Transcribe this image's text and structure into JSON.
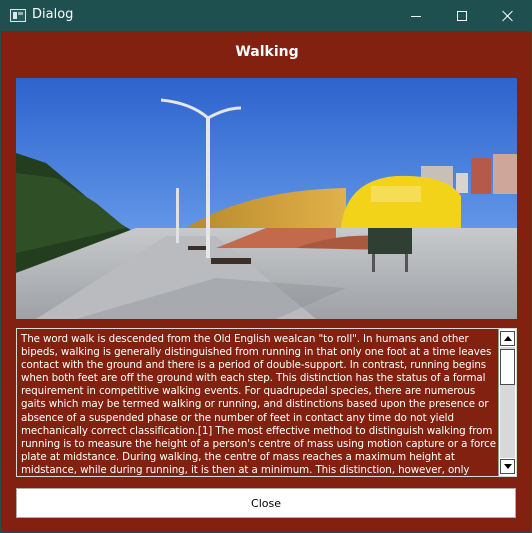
{
  "window": {
    "title": "Dialog",
    "icons": {
      "app": "window-app-icon",
      "minimize": "minimize-icon",
      "maximize": "maximize-icon",
      "close": "close-icon"
    }
  },
  "colors": {
    "titlebar": "#1f5050",
    "background": "#82210f",
    "text": "#ffffff",
    "button": "#ffffff"
  },
  "heading": "Walking",
  "image": {
    "subject": "park-walkway-photo"
  },
  "article": {
    "text": "The word walk is descended from the Old English wealcan \"to roll\". In humans and other bipeds, walking is generally distinguished from running in that only one foot at a time leaves contact with the ground and there is a period of double-support. In contrast, running begins when both feet are off the ground with each step. This distinction has the status of a formal requirement in competitive walking events. For quadrupedal species, there are numerous gaits which may be termed walking or running, and distinctions based upon the presence or absence of a suspended phase or the number of feet in contact any time do not yield mechanically correct classification.[1] The most effective method to distinguish walking from running is to measure the height of a person's centre of mass using motion capture or a force plate at midstance. During walking, the centre of mass reaches a maximum height at midstance, while during running, it is then at a minimum. This distinction, however, only holds true for locomotion over level or approximately"
  },
  "footer": {
    "close_label": "Close"
  }
}
